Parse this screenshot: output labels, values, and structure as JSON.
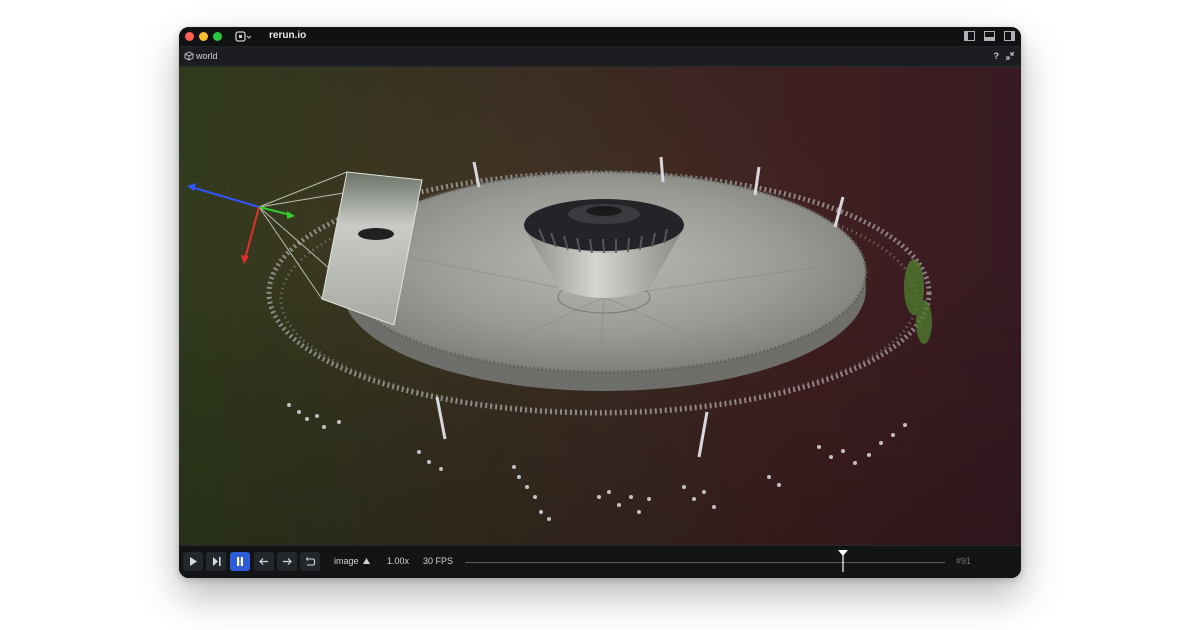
{
  "window": {
    "title": "rerun.io"
  },
  "view": {
    "name": "world",
    "help": "?"
  },
  "timeline": {
    "timeline_name": "image",
    "speed": "1.00x",
    "fps": "30 FPS",
    "frame": "#91",
    "scrub_position": 0.79,
    "is_playing": true
  },
  "colors": {
    "pause_active": "#2e5bd7",
    "axis_x": "#e03030",
    "axis_y": "#33cc33",
    "axis_z": "#3355ff",
    "camera_frustum": "#c8d0c0"
  },
  "icons": {
    "app_menu": "rerun-logo-icon",
    "view": "cube-icon",
    "collapse": "collapse-icon",
    "play": "play-icon",
    "step_end": "step-to-end-icon",
    "pause": "pause-icon",
    "prev": "arrow-left-icon",
    "next": "arrow-right-icon",
    "loop": "loop-icon",
    "dropdown": "triangle-up-icon"
  }
}
